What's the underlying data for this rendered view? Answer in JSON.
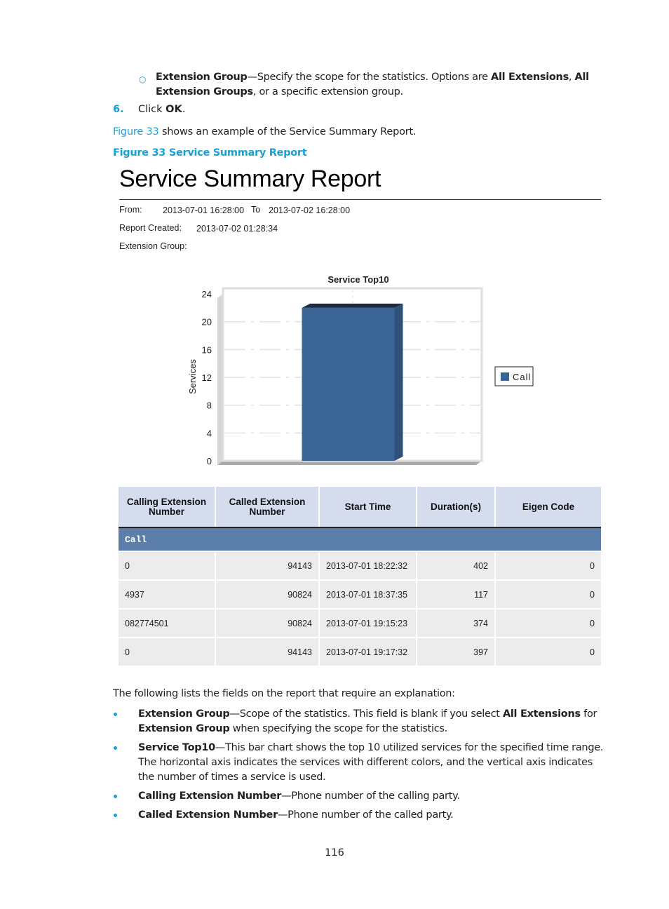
{
  "intro": {
    "sub_item": {
      "term": "Extension Group",
      "text_1": "—Specify the scope for the statistics. Options are ",
      "opt1": "All Extensions",
      "sep": ", ",
      "opt2": "All Extension Groups",
      "text_2": ", or a specific extension group."
    },
    "step": {
      "number": "6.",
      "text": "Click ",
      "bold": "OK",
      "end": "."
    },
    "figure_ref": {
      "link": "Figure 33",
      "text": " shows an example of the Service Summary Report."
    },
    "figure_caption": "Figure 33 Service Summary Report"
  },
  "report": {
    "title": "Service Summary Report",
    "from_label": "From:",
    "from_value": "2013-07-01 16:28:00",
    "to_label": "To",
    "to_value": "2013-07-02 16:28:00",
    "created_label": "Report Created:",
    "created_value": "2013-07-02 01:28:34",
    "group_label": "Extension Group:",
    "group_value": ""
  },
  "chart_data": {
    "type": "bar",
    "title": "Service Top10",
    "xlabel": "",
    "ylabel": "Services",
    "categories": [
      "Call"
    ],
    "series": [
      {
        "name": "Call",
        "values": [
          22
        ],
        "color": "#3a6595"
      }
    ],
    "ylim": [
      0,
      24
    ],
    "yticks": [
      0,
      4,
      8,
      12,
      16,
      20,
      24
    ],
    "grid": true,
    "legend": {
      "position": "right",
      "entries": [
        "Call"
      ]
    }
  },
  "table": {
    "headers": [
      "Calling Extension Number",
      "Called Extension Number",
      "Start Time",
      "Duration(s)",
      "Eigen Code"
    ],
    "group_label": "Call",
    "rows": [
      [
        "0",
        "94143",
        "2013-07-01 18:22:32",
        "402",
        "0"
      ],
      [
        "4937",
        "90824",
        "2013-07-01 18:37:35",
        "117",
        "0"
      ],
      [
        "082774501",
        "90824",
        "2013-07-01 19:15:23",
        "374",
        "0"
      ],
      [
        "0",
        "94143",
        "2013-07-01 19:17:32",
        "397",
        "0"
      ]
    ]
  },
  "explanation": {
    "intro": "The following lists the fields on the report that require an explanation:",
    "items": [
      {
        "term": "Extension Group",
        "text": "—Scope of the statistics. This field is blank if you select ",
        "b1": "All Extensions",
        "t2": " for ",
        "b2": "Extension Group",
        "t3": " when specifying the scope for the statistics."
      },
      {
        "term": "Service Top10",
        "text": "—This bar chart shows the top 10 utilized services for the specified time range. The horizontal axis indicates the services with different colors, and the vertical axis indicates the number of times a service is used."
      },
      {
        "term": "Calling Extension Number",
        "text": "—Phone number of the calling party."
      },
      {
        "term": "Called Extension Number",
        "text": "—Phone number of the called party."
      }
    ]
  },
  "page_number": "116",
  "colors": {
    "accent": "#1aa0d8",
    "bar": "#3a6595",
    "table_header": "#d4dcee",
    "group_row": "#5b7faa",
    "row_bg": "#ececec"
  }
}
